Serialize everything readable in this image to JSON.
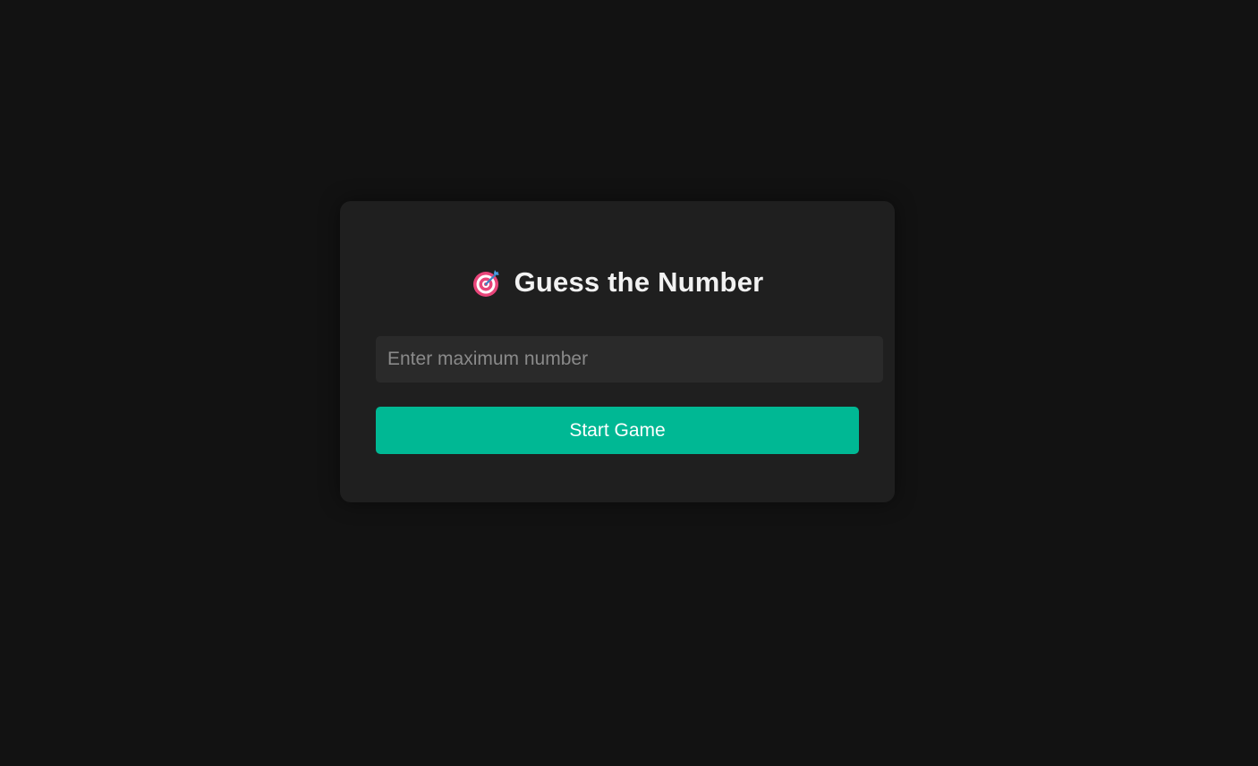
{
  "app": {
    "title": "Guess the Number",
    "title_icon": "target-icon"
  },
  "setup": {
    "max_input_placeholder": "Enter maximum number",
    "max_input_value": "",
    "start_button_label": "Start Game"
  },
  "colors": {
    "background": "#121212",
    "card": "#1f1f1f",
    "input_background": "#2a2a2a",
    "accent": "#00b894",
    "title_text": "#f2f2f2",
    "placeholder_text": "#8a8a8a"
  }
}
